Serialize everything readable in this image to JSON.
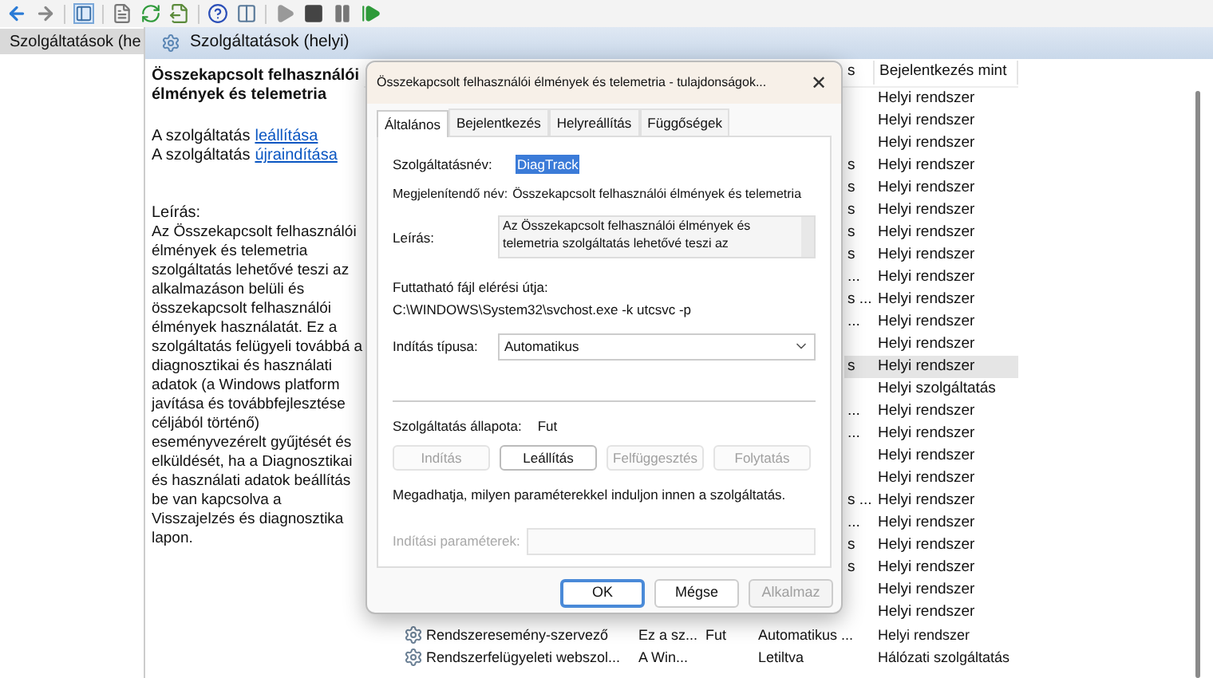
{
  "tree": {
    "items": [
      {
        "label": "Szolgáltatások (he",
        "selected": true
      }
    ]
  },
  "header": {
    "title": "Szolgáltatások (helyi)"
  },
  "details": {
    "title": "Összekapcsolt felhasználói élmények és telemetria",
    "actions": [
      {
        "prefix": "A szolgáltatás",
        "link": "leállítása"
      },
      {
        "prefix": "A szolgáltatás",
        "link": "újraindítása"
      }
    ],
    "description_label": "Leírás:",
    "description": "Az Összekapcsolt felhasználói élmények és telemetria szolgáltatás lehetővé teszi az alkalmazáson belüli és összekapcsolt felhasználói élmények használatát. Ez a szolgáltatás felügyeli továbbá a diagnosztikai és használati adatok (a Windows platform javítása és továbbfejlesztése céljából történő) eseményvezérelt gyűjtését és elküldését, ha a Diagnosztikai és használati adatok beállítás be van kapcsolva a Visszajelzés és diagnosztika lapon."
  },
  "table": {
    "columns": [
      "s",
      "Bejelentkezés mint"
    ],
    "rows": [
      {
        "kind": "covered",
        "startup": "",
        "logon": "Helyi rendszer",
        "selected": false
      },
      {
        "kind": "covered",
        "startup": "",
        "logon": "Helyi rendszer",
        "selected": false
      },
      {
        "kind": "covered",
        "startup": "",
        "logon": "Helyi rendszer",
        "selected": false
      },
      {
        "kind": "covered",
        "startup": "s",
        "logon": "Helyi rendszer",
        "selected": false
      },
      {
        "kind": "covered",
        "startup": "s",
        "logon": "Helyi rendszer",
        "selected": false
      },
      {
        "kind": "covered",
        "startup": "s",
        "logon": "Helyi rendszer",
        "selected": false
      },
      {
        "kind": "covered",
        "startup": "s",
        "logon": "Helyi rendszer",
        "selected": false
      },
      {
        "kind": "covered",
        "startup": "s",
        "logon": "Helyi rendszer",
        "selected": false
      },
      {
        "kind": "covered",
        "startup": "...",
        "logon": "Helyi rendszer",
        "selected": false
      },
      {
        "kind": "covered",
        "startup": "s ...",
        "logon": "Helyi rendszer",
        "selected": false
      },
      {
        "kind": "covered",
        "startup": "...",
        "logon": "Helyi rendszer",
        "selected": false
      },
      {
        "kind": "covered",
        "startup": "",
        "logon": "Helyi rendszer",
        "selected": false
      },
      {
        "kind": "covered",
        "startup": "s",
        "logon": "Helyi rendszer",
        "selected": true
      },
      {
        "kind": "covered",
        "startup": "",
        "logon": "Helyi szolgáltatás",
        "selected": false
      },
      {
        "kind": "covered",
        "startup": "...",
        "logon": "Helyi rendszer",
        "selected": false
      },
      {
        "kind": "covered",
        "startup": "...",
        "logon": "Helyi rendszer",
        "selected": false
      },
      {
        "kind": "covered",
        "startup": "",
        "logon": "Helyi rendszer",
        "selected": false
      },
      {
        "kind": "covered",
        "startup": "",
        "logon": "Helyi rendszer",
        "selected": false
      },
      {
        "kind": "covered",
        "startup": "s ...",
        "logon": "Helyi rendszer",
        "selected": false
      },
      {
        "kind": "covered",
        "startup": "...",
        "logon": "Helyi rendszer",
        "selected": false
      },
      {
        "kind": "covered",
        "startup": "s",
        "logon": "Helyi rendszer",
        "selected": false
      },
      {
        "kind": "covered",
        "startup": "s",
        "logon": "Helyi rendszer",
        "selected": false
      },
      {
        "kind": "covered",
        "startup": "",
        "logon": "Helyi rendszer",
        "selected": false
      },
      {
        "kind": "covered",
        "startup": "",
        "logon": "Helyi rendszer",
        "selected": false
      },
      {
        "kind": "full",
        "name": "Rendszeresemény-szervező",
        "description": "Ez a sz...",
        "status": "Fut",
        "startup": "Automatikus ...",
        "logon": "Helyi rendszer",
        "selected": false
      },
      {
        "kind": "full",
        "name": "Rendszerfelügyeleti webszol...",
        "description": "A Win...",
        "status": "",
        "startup": "Letiltva",
        "logon": "Hálózati szolgáltatás",
        "selected": false
      }
    ]
  },
  "dialog": {
    "title": "Összekapcsolt felhasználói élmények és telemetria - tulajdonságok...",
    "close": "✕",
    "tabs": [
      {
        "label": "Általános",
        "selected": true
      },
      {
        "label": "Bejelentkezés",
        "selected": false
      },
      {
        "label": "Helyreállítás",
        "selected": false
      },
      {
        "label": "Függőségek",
        "selected": false
      }
    ],
    "service_name_label": "Szolgáltatásnév:",
    "service_name": "DiagTrack",
    "display_name_label": "Megjelenítendő név:",
    "display_name": "Összekapcsolt felhasználói élmények és telemetria",
    "description_label": "Leírás:",
    "description": "Az Összekapcsolt felhasználói élmények és telemetria szolgáltatás lehetővé teszi az",
    "path_label": "Futtatható fájl elérési útja:",
    "path": "C:\\WINDOWS\\System32\\svchost.exe -k utcsvc -p",
    "startup_label": "Indítás típusa:",
    "startup_value": "Automatikus",
    "status_label": "Szolgáltatás állapota:",
    "status": "Fut",
    "service_buttons": [
      {
        "label": "Indítás",
        "disabled": true
      },
      {
        "label": "Leállítás",
        "disabled": false
      },
      {
        "label": "Felfüggesztés",
        "disabled": true
      },
      {
        "label": "Folytatás",
        "disabled": true
      }
    ],
    "hint": "Megadhatja, milyen paraméterekkel induljon innen a szolgáltatás.",
    "params_label": "Indítási paraméterek:",
    "params_disabled": true,
    "buttons": [
      {
        "label": "OK",
        "default": true,
        "disabled": false
      },
      {
        "label": "Mégse",
        "default": false,
        "disabled": false
      },
      {
        "label": "Alkalmaz",
        "default": false,
        "disabled": true
      }
    ]
  }
}
